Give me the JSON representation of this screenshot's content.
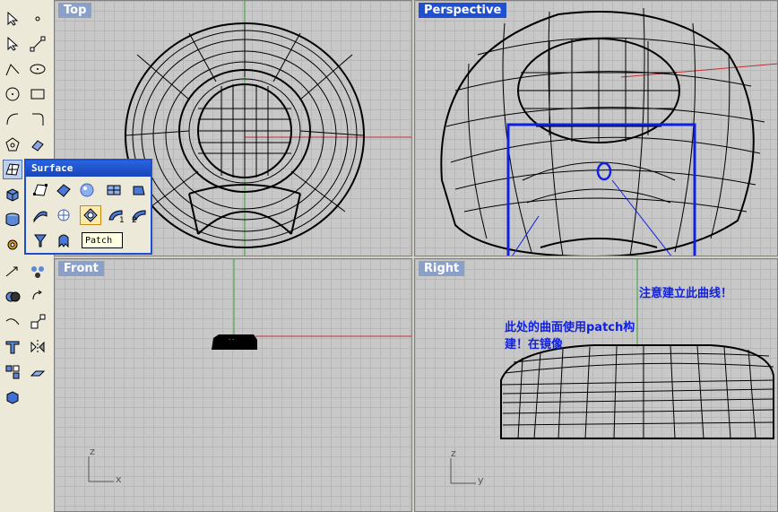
{
  "viewports": {
    "top": {
      "label": "Top"
    },
    "perspective": {
      "label": "Perspective"
    },
    "front": {
      "label": "Front"
    },
    "right": {
      "label": "Right"
    }
  },
  "axes": {
    "front": {
      "z": "z",
      "x": "x"
    },
    "right": {
      "z": "z",
      "y": "y"
    }
  },
  "popup": {
    "title": "Surface",
    "tooltip": "Patch",
    "digit_1": "1",
    "digit_2": "2"
  },
  "annotations": {
    "curve_note": "注意建立此曲线！",
    "patch_note_line1": "此处的曲面使用patch构",
    "patch_note_line2": "建！在镜像"
  },
  "front_object_text": "- -",
  "colors": {
    "viewport_bg": "#c8c8c8",
    "active_label": "#2050d0",
    "inactive_label": "#8aa0c8",
    "annotation": "#1020e0",
    "x_axis": "#c03030",
    "y_axis": "#30a030"
  }
}
